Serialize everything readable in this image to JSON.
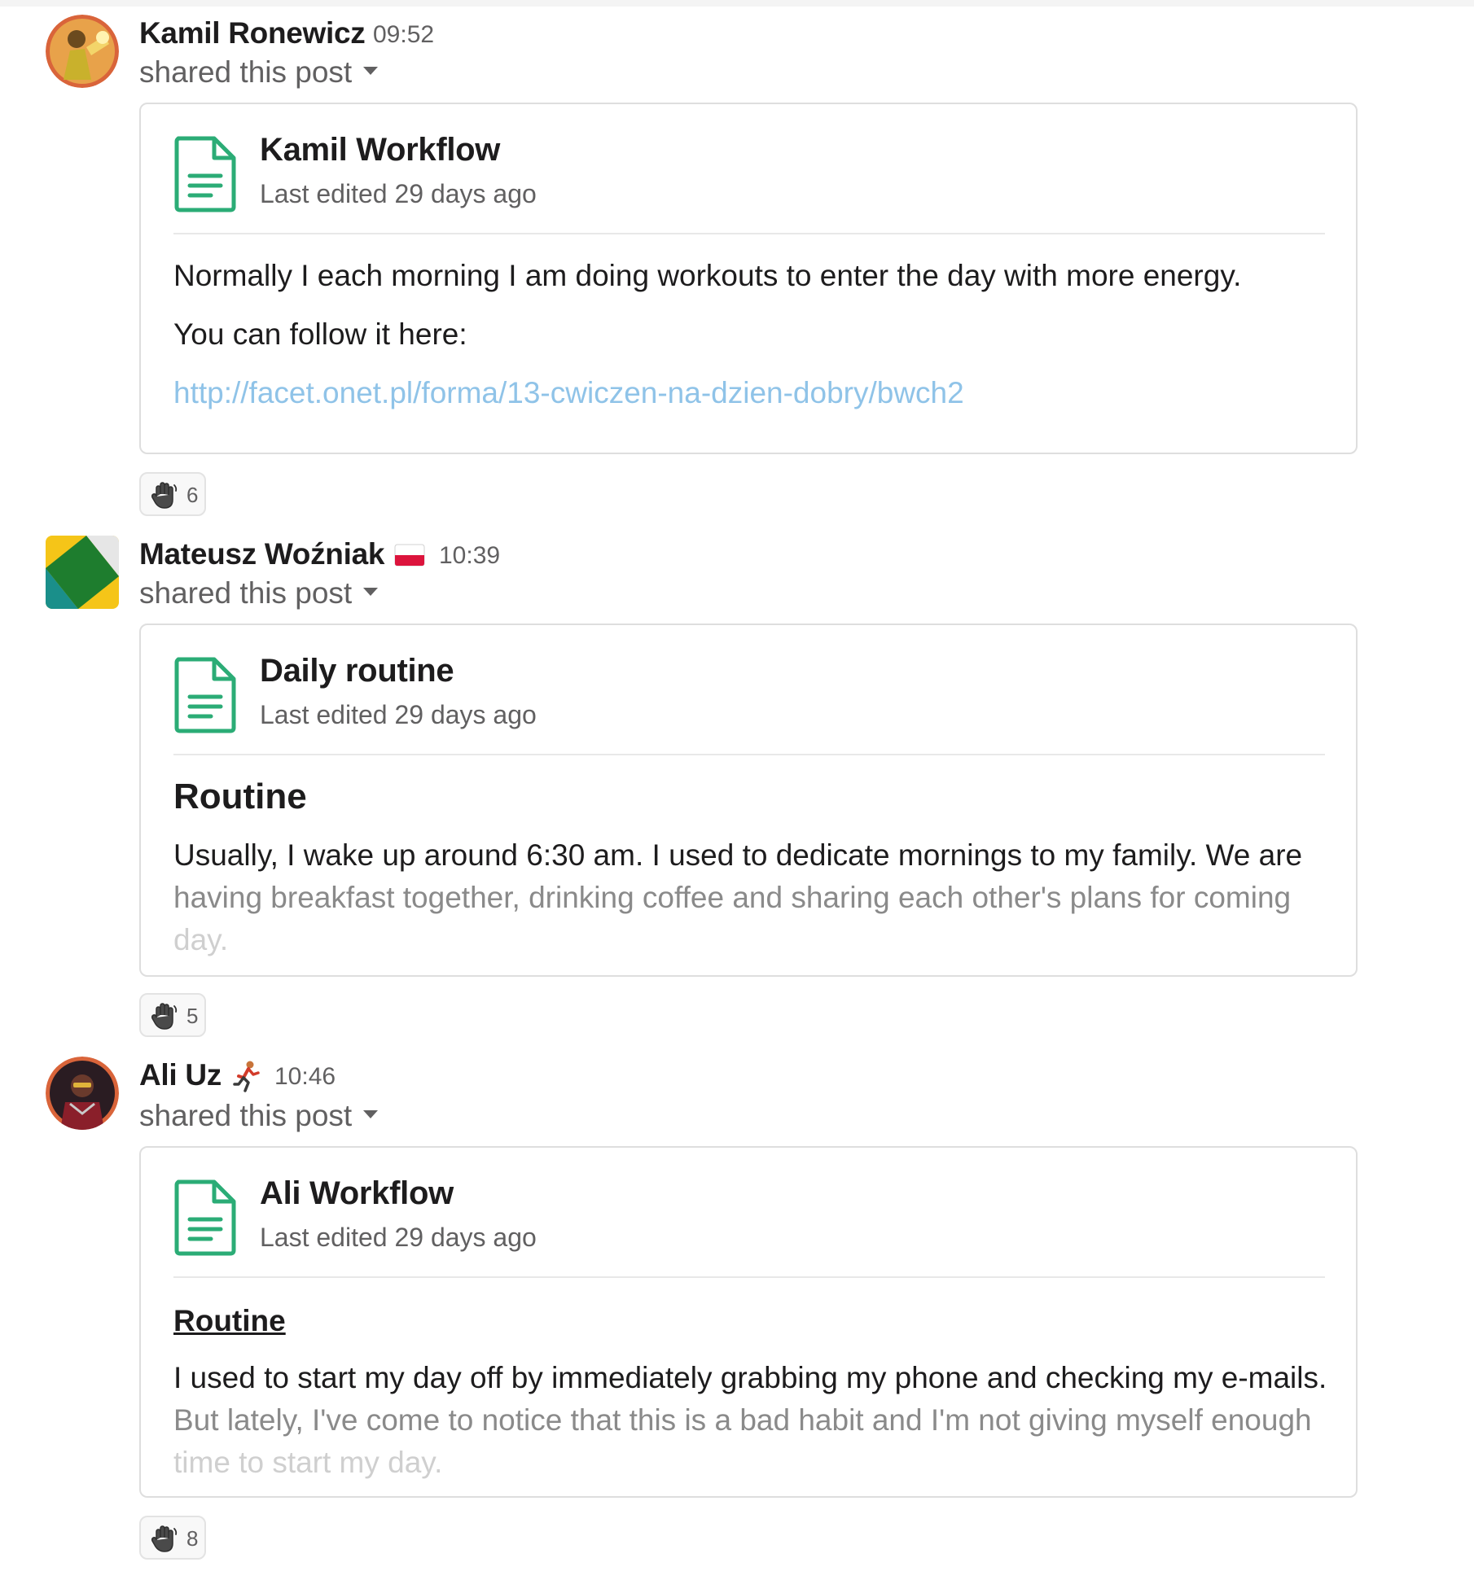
{
  "messages": [
    {
      "user": "Kamil Ronewicz",
      "time": "09:52",
      "action": "shared this post",
      "doc_title": "Kamil Workflow",
      "edited": "Last edited 29 days ago",
      "body": [
        "Normally I each morning I am doing workouts to enter the day with more energy.",
        "You can follow it here:"
      ],
      "link": "http://facet.onet.pl/forma/13-cwiczen-na-dzien-dobry/bwch2",
      "reaction_icon": "raised-hand-icon",
      "reaction_count": "6"
    },
    {
      "user": "Mateusz Woźniak",
      "status_icon": "poland-flag-icon",
      "time": "10:39",
      "action": "shared this post",
      "doc_title": "Daily routine",
      "edited": "Last edited 29 days ago",
      "heading": "Routine",
      "body": [
        "Usually, I wake up around 6:30 am. I used to dedicate mornings to my family. We are",
        "having breakfast together, drinking coffee and sharing each other's plans for coming",
        "day."
      ],
      "reaction_icon": "raised-hand-icon",
      "reaction_count": "5"
    },
    {
      "user": "Ali Uz",
      "status_icon": "runner-icon",
      "time": "10:46",
      "action": "shared this post",
      "doc_title": "Ali Workflow",
      "edited": "Last edited 29 days ago",
      "heading": "Routine",
      "body": [
        "I used to start my day off by immediately grabbing my phone and checking my e-mails.",
        "But lately, I've come to notice that this is a bad habit and I'm not giving myself enough",
        "time to start my day."
      ],
      "reaction_icon": "raised-hand-icon",
      "reaction_count": "8"
    }
  ],
  "colors": {
    "link": "#8fc3e8",
    "doc_icon": "#2bac76",
    "muted_text": "#616061",
    "card_border": "#dedede"
  }
}
